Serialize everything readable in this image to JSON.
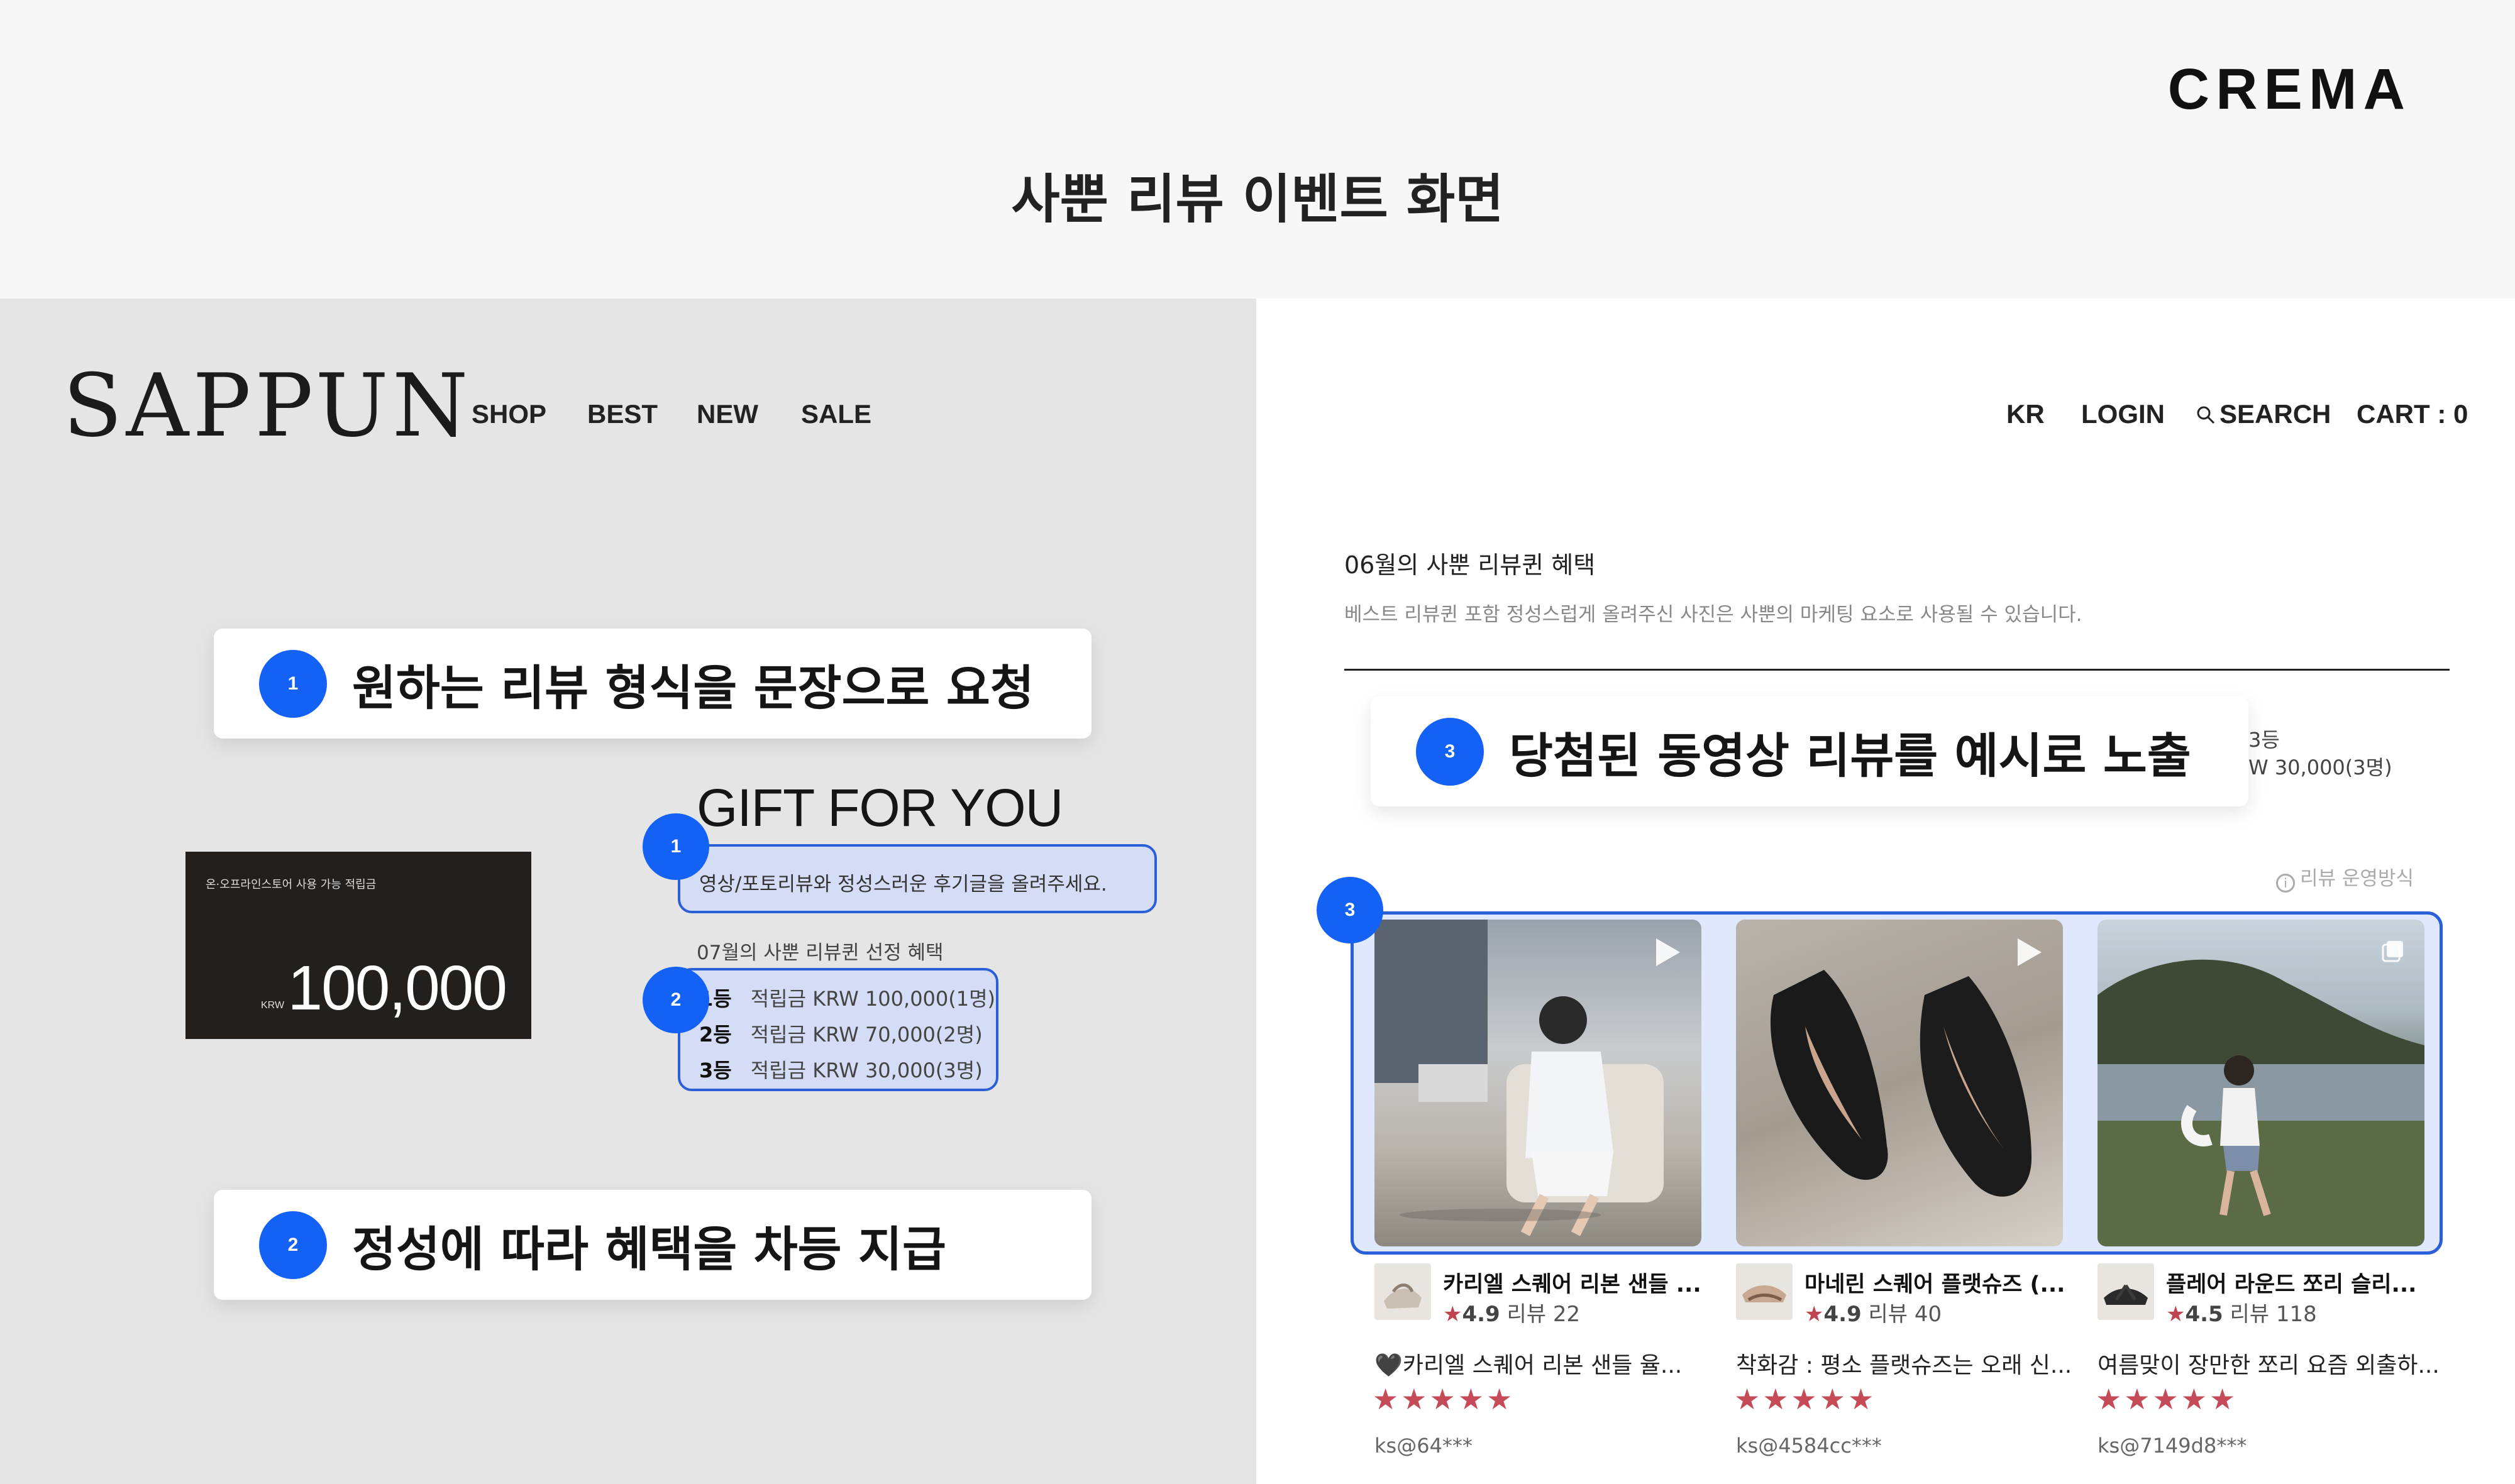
{
  "brand": {
    "logo": "CREMA"
  },
  "title": "사뿐 리뷰 이벤트 화면",
  "store": {
    "logo": "SAPPUN",
    "nav_left": [
      "SHOP",
      "BEST",
      "NEW",
      "SALE"
    ],
    "nav_right": {
      "lang": "KR",
      "login": "LOGIN",
      "search": "SEARCH",
      "cart": "CART : 0"
    }
  },
  "callouts": [
    {
      "number": "1",
      "text": "원하는 리뷰 형식을 문장으로 요청"
    },
    {
      "number": "2",
      "text": "정성에 따라 혜택을 차등 지급"
    },
    {
      "number": "3",
      "text": "당첨된 동영상 리뷰를 예시로 노출"
    }
  ],
  "pins": {
    "p1": "1",
    "p2": "2",
    "p3": "3"
  },
  "reward_card": {
    "label": "온·오프라인스토어 사용 가능 적립금",
    "currency": "KRW",
    "amount": "100,000"
  },
  "gift": {
    "title": "GIFT FOR YOU",
    "description": "영상/포토리뷰와 정성스러운 후기글을 올려주세요.",
    "rank_title": "07월의 사뿐 리뷰퀸 선정 혜택",
    "ranks": [
      {
        "rank": "1등",
        "benefit": "적립금 KRW 100,000(1명)"
      },
      {
        "rank": "2등",
        "benefit": "적립금 KRW 70,000(2명)"
      },
      {
        "rank": "3등",
        "benefit": "적립금 KRW 30,000(3명)"
      }
    ]
  },
  "month_section": {
    "title": "06월의 사뿐 리뷰퀸 혜택",
    "subtitle": "베스트 리뷰퀸 포함 정성스럽게 올려주신 사진은 사뿐의 마케팅 요소로 사용될 수 있습니다.",
    "partial_rank": "3등",
    "partial_benefit": "W 30,000(3명)",
    "review_policy": "리뷰 운영방식"
  },
  "reviews": [
    {
      "media": "video",
      "product": "카리엘 스퀘어 리본 샌들 ...",
      "rating": "4.9",
      "review_count": "리뷰 22",
      "text": "🖤카리엘 스퀘어 리본 샌들 율...",
      "stars": "★★★★★",
      "reviewer": "ks@64***"
    },
    {
      "media": "video",
      "product": "마네린 스퀘어 플랫슈즈 (...",
      "rating": "4.9",
      "review_count": "리뷰 40",
      "text": "착화감 : 평소 플랫슈즈는 오래 신...",
      "stars": "★★★★★",
      "reviewer": "ks@4584cc***"
    },
    {
      "media": "photo",
      "product": "플레어 라운드 쪼리 슬리...",
      "rating": "4.5",
      "review_count": "리뷰 118",
      "text": "여름맞이 장만한 쪼리 요즘 외출하...",
      "stars": "★★★★★",
      "reviewer": "ks@7149d8***"
    }
  ]
}
